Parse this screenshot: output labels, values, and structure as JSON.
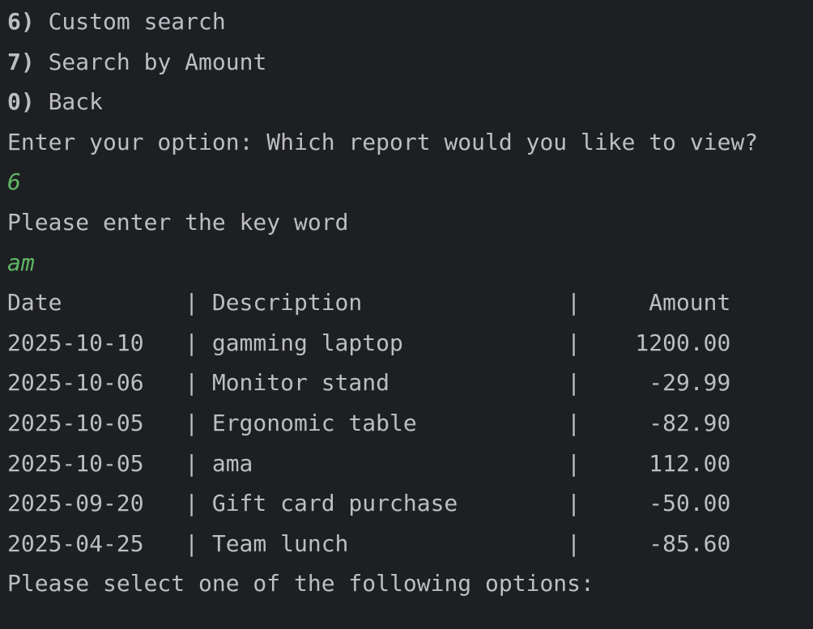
{
  "menu": [
    {
      "key": "6)",
      "label": "Custom search"
    },
    {
      "key": "7)",
      "label": "Search by Amount"
    },
    {
      "key": "0)",
      "label": "Back"
    }
  ],
  "prompt_option": "Enter your option: Which report would you like to view?",
  "input_option": "6",
  "prompt_keyword": "Please enter the key word",
  "input_keyword": "am",
  "table": {
    "separator": "|",
    "headers": {
      "date": "Date",
      "description": "Description",
      "amount": "Amount"
    },
    "rows": [
      {
        "date": "2025-10-10",
        "description": "gamming laptop",
        "amount": "1200.00"
      },
      {
        "date": "2025-10-06",
        "description": "Monitor stand",
        "amount": "-29.99"
      },
      {
        "date": "2025-10-05",
        "description": "Ergonomic table",
        "amount": "-82.90"
      },
      {
        "date": "2025-10-05",
        "description": "ama",
        "amount": "112.00"
      },
      {
        "date": "2025-09-20",
        "description": "Gift card purchase",
        "amount": "-50.00"
      },
      {
        "date": "2025-04-25",
        "description": "Team lunch",
        "amount": "-85.60"
      }
    ]
  },
  "footer_prompt": "Please select one of the following options:"
}
